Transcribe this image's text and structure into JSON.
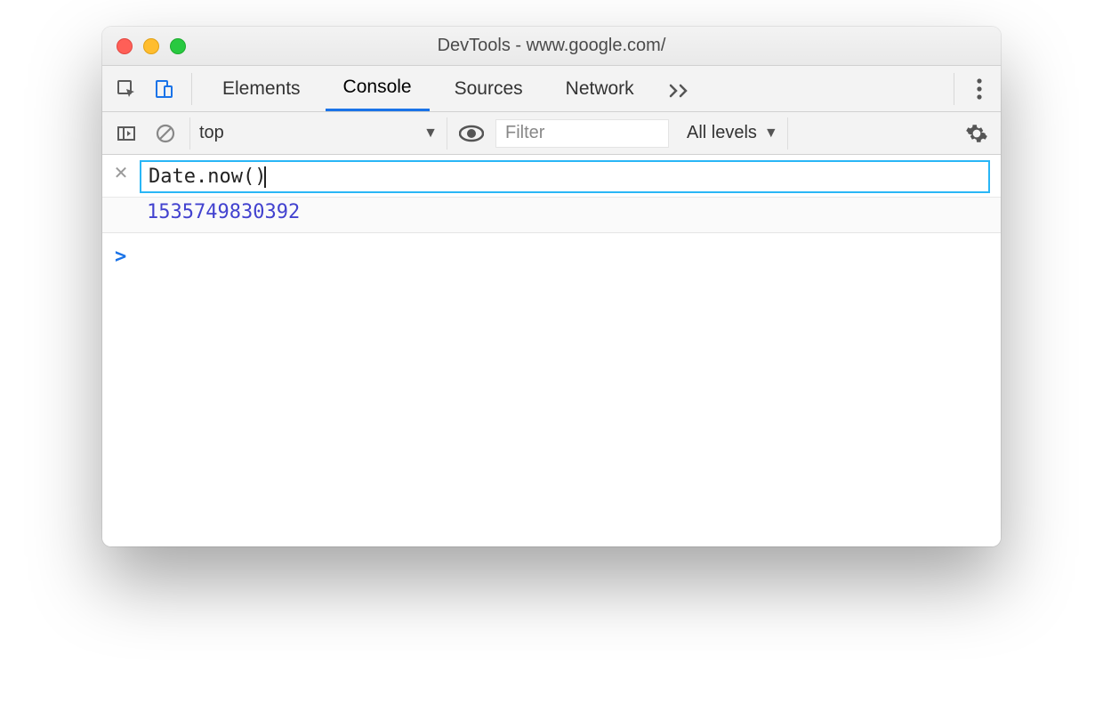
{
  "window": {
    "title": "DevTools - www.google.com/"
  },
  "tabs": {
    "items": [
      "Elements",
      "Console",
      "Sources",
      "Network"
    ],
    "active": "Console"
  },
  "toolbar": {
    "context": "top",
    "filter_placeholder": "Filter",
    "levels_label": "All levels"
  },
  "console": {
    "expression": "Date.now()",
    "result": "1535749830392",
    "prompt": ">"
  }
}
